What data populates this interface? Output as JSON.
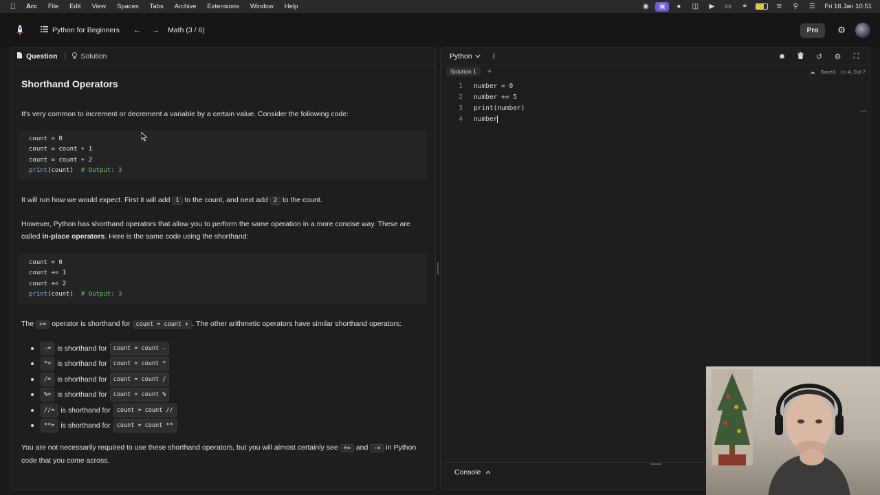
{
  "menubar": {
    "items": [
      "Arc",
      "File",
      "Edit",
      "View",
      "Spaces",
      "Tabs",
      "Archive",
      "Extensions",
      "Window",
      "Help"
    ],
    "clock": "Fri 16 Jan  10:51"
  },
  "appbar": {
    "course_title": "Python for Beginners",
    "lesson_position": "Math (3 / 6)",
    "pro_label": "Pro"
  },
  "left": {
    "tabs": {
      "question": "Question",
      "solution": "Solution"
    },
    "title": "Shorthand Operators",
    "p1": "It's very common to increment or decrement a variable by a certain value. Consider the following code:",
    "code1": {
      "l1": "count = 0",
      "l2": "count = count + 1",
      "l3": "count = count + 2",
      "l4_fn": "print",
      "l4_args": "(count)",
      "l4_comment": "# Output: 3"
    },
    "p2": {
      "a": "It will run how we would expect. First it will add",
      "code_a": "1",
      "b": "to the count, and next add",
      "code_b": "2",
      "c": "to the count."
    },
    "p3": {
      "a": "However, Python has shorthand operators that allow you to perform the same operation in a more concise way. These are called",
      "bold": "in-place operators",
      "b": ". Here is the same code using the shorthand:"
    },
    "code2": {
      "l1": "count = 0",
      "l2": "count += 1",
      "l3": "count += 2",
      "l4_fn": "print",
      "l4_args": "(count)",
      "l4_comment": "# Output: 3"
    },
    "p4": {
      "a": "The",
      "code_a": "+=",
      "b": "operator is shorthand for",
      "code_b": "count = count +",
      "c": ". The other arithmetic operators have similar shorthand operators:"
    },
    "bullets": [
      {
        "op": "-=",
        "text": "is shorthand for",
        "expr": "count = count -"
      },
      {
        "op": "*=",
        "text": "is shorthand for",
        "expr": "count = count *"
      },
      {
        "op": "/=",
        "text": "is shorthand for",
        "expr": "count = count /"
      },
      {
        "op": "%=",
        "text": "is shorthand for",
        "expr": "count = count %"
      },
      {
        "op": "//=",
        "text": "is shorthand for",
        "expr": "count = count //"
      },
      {
        "op": "**=",
        "text": "is shorthand for",
        "expr": "count = count **"
      }
    ],
    "p5": {
      "a": "You are not necessarily required to use these shorthand operators, but you will almost certainly see",
      "code_a": "+=",
      "b": "and",
      "code_b": "-=",
      "c": "in Python code that you come across."
    }
  },
  "editor": {
    "language": "Python",
    "info": "i",
    "solution_tab": "Solution 1",
    "add_tab": "+",
    "saved": "Saved",
    "cursor_pos": "Ln 4, Col 7",
    "lines": [
      {
        "n": "1",
        "code": "number = 0"
      },
      {
        "n": "2",
        "code": "number += 5"
      },
      {
        "n": "3",
        "code": "print(number)"
      },
      {
        "n": "4",
        "code": "number"
      }
    ],
    "console_label": "Console"
  }
}
